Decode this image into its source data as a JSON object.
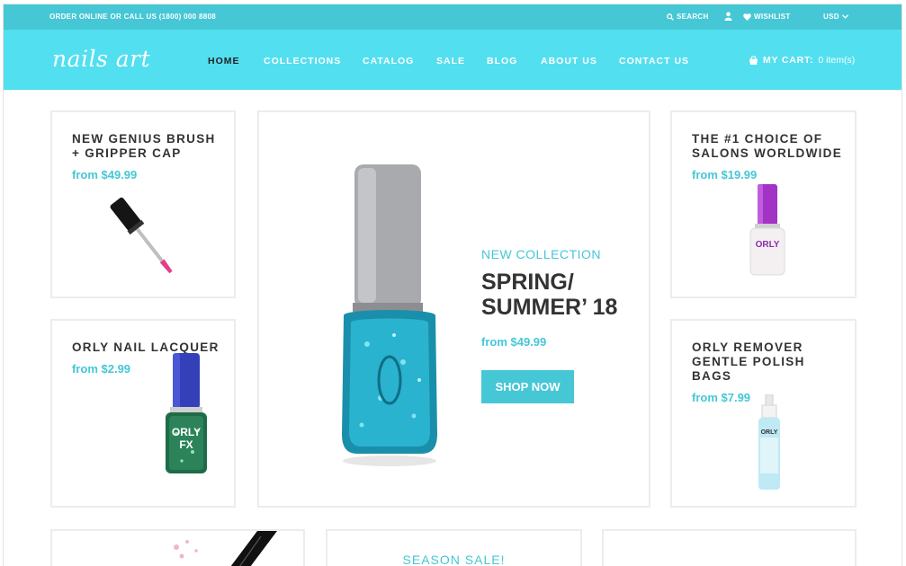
{
  "topbar": {
    "phone_text": "ORDER ONLINE OR CALL US (1800) 000 8808",
    "search_label": "SEARCH",
    "wishlist_label": "WISHLIST",
    "currency_label": "USD"
  },
  "header": {
    "logo_text": "nails art",
    "nav": [
      "HOME",
      "COLLECTIONS",
      "CATALOG",
      "SALE",
      "BLOG",
      "ABOUT US",
      "CONTACT US"
    ],
    "active_nav": "HOME",
    "cart_label": "MY CART:",
    "cart_count": "0 item(s)"
  },
  "products": {
    "p1": {
      "title_line1": "NEW GENIUS BRUSH",
      "title_line2": "+ GRIPPER CAP",
      "price": "from $49.99"
    },
    "p2": {
      "title_line1": "ORLY NAIL LACQUER",
      "price": "from $2.99",
      "bottle_brand": "ORLY",
      "bottle_sub": "FX"
    },
    "p3": {
      "title_line1": "THE #1 CHOICE OF",
      "title_line2": "SALONS WORLDWIDE",
      "price": "from $19.99",
      "bottle_brand": "ORLY"
    },
    "p4": {
      "title_line1": "ORLY REMOVER",
      "title_line2": "GENTLE POLISH",
      "title_line3": "BAGS",
      "price": "from $7.99",
      "bottle_brand": "ORLY"
    }
  },
  "hero": {
    "kicker": "NEW COLLECTION",
    "headline_line1": "SPRING/",
    "headline_line2": "SUMMER’ 18",
    "price": "from $49.99",
    "button_label": "SHOP NOW"
  },
  "bottom": {
    "sale_text": "SEASON SALE!"
  },
  "colors": {
    "accent": "#45c7d6",
    "header_bg": "#52dff0",
    "topbar_bg": "#45c7d6",
    "text_dark": "#333333"
  }
}
